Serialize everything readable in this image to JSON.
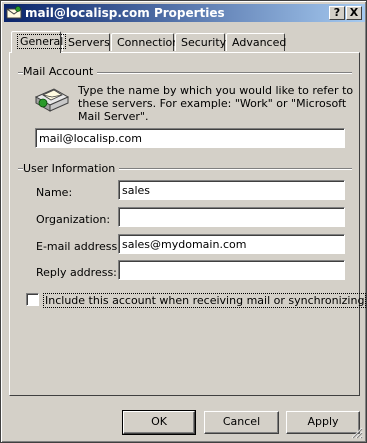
{
  "window": {
    "title": "mail@localisp.com Properties",
    "help_label": "?",
    "close_label": "X"
  },
  "tabs": [
    {
      "label": "General",
      "active": true
    },
    {
      "label": "Servers"
    },
    {
      "label": "Connection"
    },
    {
      "label": "Security"
    },
    {
      "label": "Advanced"
    }
  ],
  "mail_account": {
    "group_label": "Mail Account",
    "description": "Type the name by which you would like to refer to these servers.  For example: \"Work\" or \"Microsoft Mail Server\".",
    "account_name": "mail@localisp.com"
  },
  "user_info": {
    "group_label": "User Information",
    "name_label": "Name:",
    "name_value": "sales",
    "organization_label": "Organization:",
    "organization_value": "",
    "email_label": "E-mail address:",
    "email_value": "sales@mydomain.com",
    "reply_label": "Reply address:",
    "reply_value": ""
  },
  "include_checkbox": {
    "label": "Include this account when receiving mail or synchronizing",
    "checked": false
  },
  "buttons": {
    "ok": "OK",
    "cancel": "Cancel",
    "apply": "Apply"
  },
  "colors": {
    "titlebar_start": "#0a246a",
    "titlebar_end": "#a6caf0",
    "face": "#d4d0c8"
  }
}
